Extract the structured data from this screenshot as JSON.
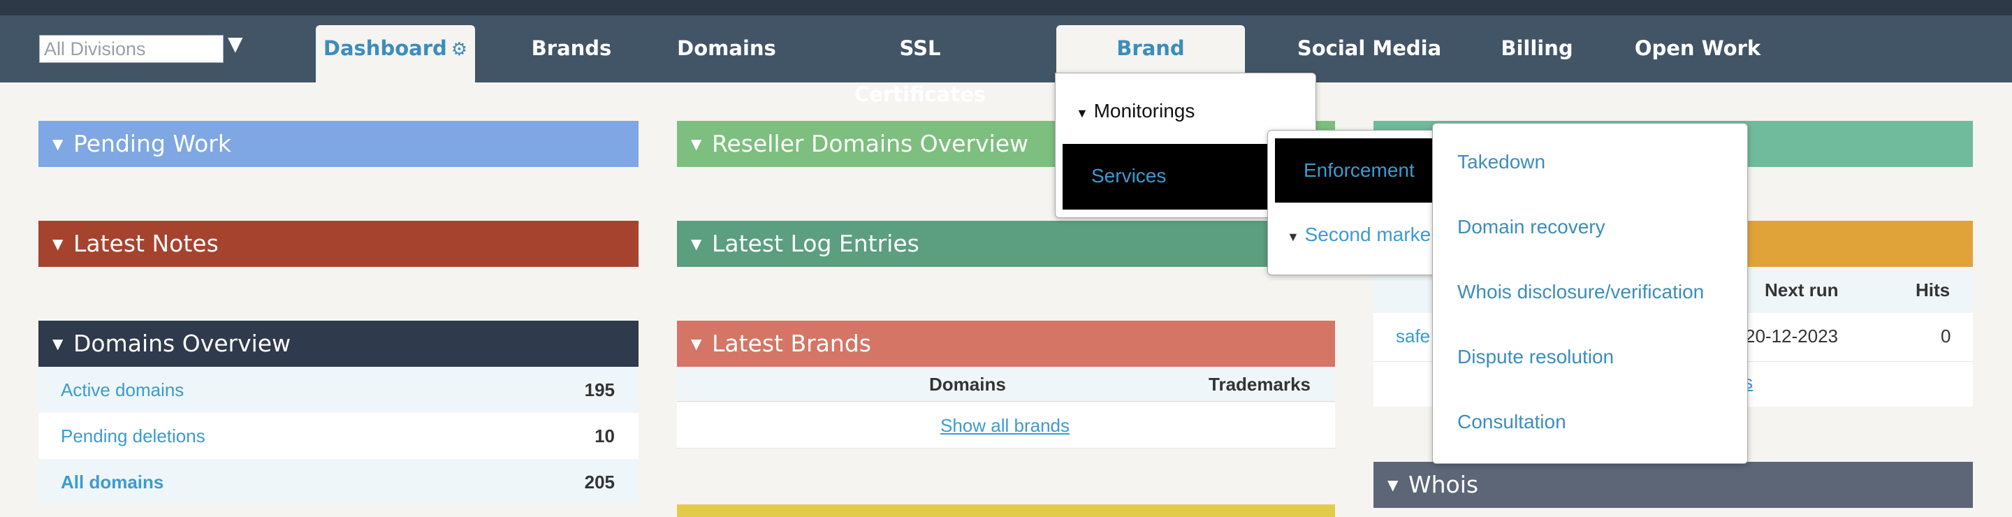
{
  "nav": {
    "division_select": "All Divisions",
    "items": [
      {
        "label": "Dashboard"
      },
      {
        "label": "Brands"
      },
      {
        "label": "Domains"
      },
      {
        "label": "SSL Certificates"
      },
      {
        "label": "Brand Protection"
      },
      {
        "label": "Social Media"
      },
      {
        "label": "Billing"
      },
      {
        "label": "Open Work"
      }
    ]
  },
  "panels": {
    "pending_work": "Pending Work",
    "latest_notes": "Latest Notes",
    "domains_overview": "Domains Overview",
    "reseller_domains": "Reseller Domains Overview",
    "latest_log": "Latest Log Entries",
    "latest_brands": "Latest Brands",
    "whois": "Whois"
  },
  "domains_overview": {
    "rows": [
      {
        "label": "Active domains",
        "value": "195"
      },
      {
        "label": "Pending deletions",
        "value": "10"
      },
      {
        "label": "All domains",
        "value": "205"
      }
    ]
  },
  "latest_brands": {
    "col_domains": "Domains",
    "col_trademarks": "Trademarks",
    "show_all": "Show all brands"
  },
  "monitoring_table": {
    "col_next_run": "Next run",
    "col_hits": "Hits",
    "row_name": "safe",
    "row_next_run": "20-12-2023",
    "row_hits": "0",
    "link_fragment": "s"
  },
  "brand_protection_menu": {
    "monitorings": "Monitorings",
    "services": "Services"
  },
  "services_menu": {
    "enforcement": "Enforcement",
    "second_market": "Second marke"
  },
  "enforcement_menu": {
    "items": [
      "Takedown",
      "Domain recovery",
      "Whois disclosure/verification",
      "Dispute resolution",
      "Consultation"
    ]
  },
  "colors": {
    "navbar": "#425567",
    "pending_work": "#7ea7e3",
    "latest_notes": "#a6432e",
    "domains_overview": "#2f3a4c",
    "reseller": "#7dbf7e",
    "latest_log": "#5b9e80",
    "latest_brands": "#d47566",
    "whois": "#5c6677",
    "link": "#3c9bd0"
  }
}
